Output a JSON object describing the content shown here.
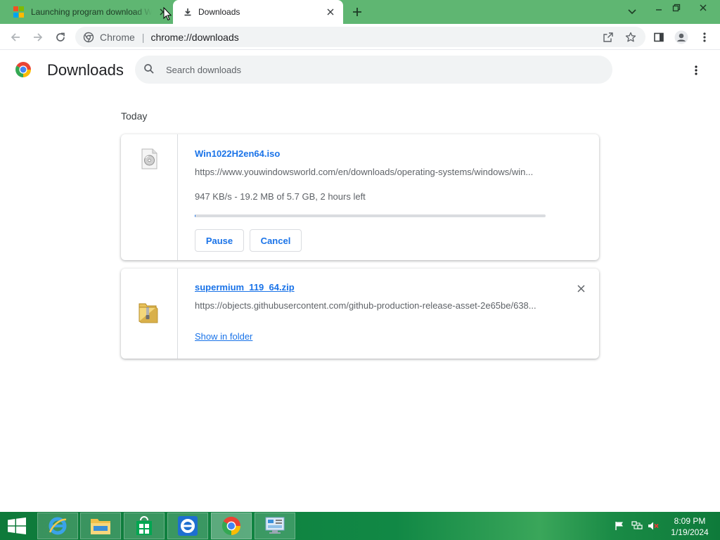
{
  "window": {
    "tabs": [
      {
        "title": "Launching program download W",
        "icon": "windows-logo-icon",
        "active": false
      },
      {
        "title": "Downloads",
        "icon": "download-icon",
        "active": true
      }
    ],
    "controls": [
      "chevron-down-icon",
      "minimize-icon",
      "restore-icon",
      "close-icon"
    ]
  },
  "toolbar": {
    "site_chip": "Chrome",
    "url": "chrome://downloads"
  },
  "header": {
    "title": "Downloads",
    "search_placeholder": "Search downloads"
  },
  "downloads": {
    "date_heading": "Today",
    "items": [
      {
        "file_name": "Win1022H2en64.iso",
        "url": "https://www.youwindowsworld.com/en/downloads/operating-systems/windows/win...",
        "status": "947 KB/s - 19.2 MB of 5.7 GB, 2 hours left",
        "progress_fraction": 0.003,
        "pause_label": "Pause",
        "cancel_label": "Cancel",
        "icon": "disc-file-icon"
      },
      {
        "file_name": "supermium_119_64.zip",
        "url": "https://objects.githubusercontent.com/github-production-release-asset-2e65be/638...",
        "action_label": "Show in folder",
        "icon": "zip-folder-icon"
      }
    ]
  },
  "taskbar": {
    "apps": [
      "internet-explorer-icon",
      "file-explorer-icon",
      "store-icon",
      "internet-explorer-icon",
      "chrome-icon",
      "control-panel-icon"
    ],
    "time": "8:09 PM",
    "date": "1/19/2024"
  },
  "colors": {
    "titlebar": "#5fb672",
    "accent": "#1a73e8",
    "taskbar": "#118845"
  }
}
